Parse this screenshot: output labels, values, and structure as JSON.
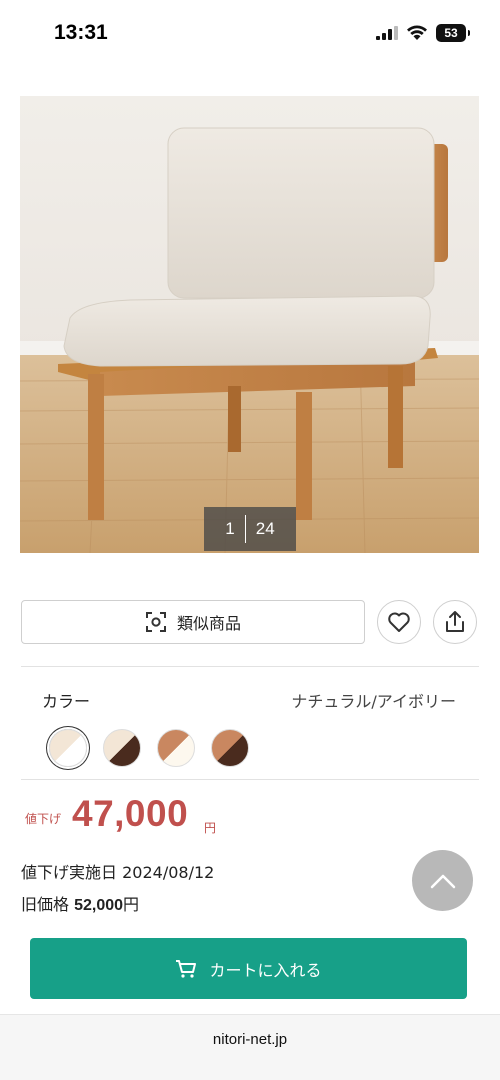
{
  "status_bar": {
    "time": "13:31",
    "battery": "53"
  },
  "product": {
    "image_counter_current": "1",
    "image_counter_total": "24",
    "similar_button_label": "類似商品",
    "color_label": "カラー",
    "color_value": "ナチュラル/アイボリー",
    "swatches": [
      {
        "left": "#f3e6d6",
        "right": "#ffffff",
        "selected": true
      },
      {
        "left": "#f3e6d6",
        "right": "#4a2b1e",
        "selected": false
      },
      {
        "left": "#c98760",
        "right": "#ffffff",
        "selected": false
      },
      {
        "left": "#c98760",
        "right": "#4a2b1e",
        "selected": false
      }
    ],
    "sale_tag": "値下げ",
    "price": "47,000",
    "yen": "円",
    "discount_date_label": "値下げ実施日",
    "discount_date": "2024/08/12",
    "old_price_label": "旧価格",
    "old_price": "52,000",
    "old_price_yen": "円",
    "cart_button_label": "カートに入れる"
  },
  "browser": {
    "url": "nitori-net.jp"
  },
  "colors": {
    "accent_green": "#17a088",
    "sale_red": "#c0504d"
  }
}
